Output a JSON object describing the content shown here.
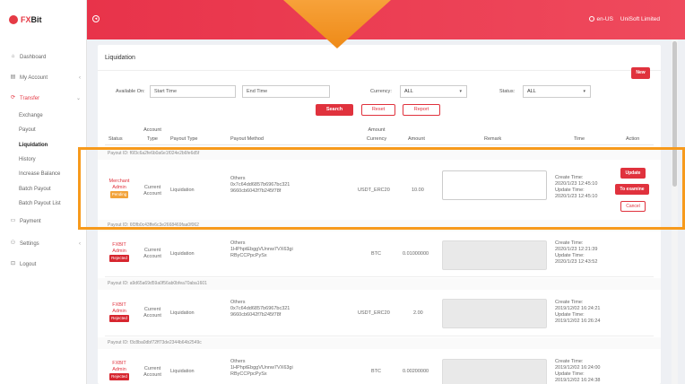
{
  "brand": {
    "prefix": "FX",
    "suffix": "Bit"
  },
  "topbar": {
    "language": "en-US",
    "company": "UniSoft Limited"
  },
  "sidebar": {
    "items": [
      {
        "label": "Dashboard",
        "icon": "home-icon"
      },
      {
        "label": "My Account",
        "icon": "account-icon"
      },
      {
        "label": "Transfer",
        "icon": "transfer-icon"
      }
    ],
    "transfer_sub": [
      "Exchange",
      "Payout",
      "Liquidation",
      "History",
      "Increase Balance",
      "Batch Payout",
      "Batch Payout List"
    ],
    "payment": "Payment",
    "settings": "Settings",
    "logout": "Logout"
  },
  "page": {
    "title": "Liquidation",
    "new_label": "New",
    "filters": {
      "available_on": "Available On",
      "start_placeholder": "Start Time",
      "end_placeholder": "End Time",
      "currency_label": "Currency",
      "currency_value": "ALL",
      "status_label": "Status",
      "status_value": "ALL",
      "search": "Search",
      "reset": "Reset",
      "report": "Report"
    },
    "columns": {
      "status": "Status",
      "account_type_1": "Account",
      "account_type_2": "Type",
      "payout_type": "Payout Type",
      "payout_method": "Payout Method",
      "amount_currency_1": "Amount",
      "amount_currency_2": "Currency",
      "amount": "Amount",
      "remark": "Remark",
      "time": "Time",
      "action": "Action"
    }
  },
  "rows": [
    {
      "payout_id": "Payout ID: f6f3c6a2fe6b0a6e1f024e2b6fe6d5f",
      "status_1": "Merchant",
      "status_2": "Admin",
      "badge": "Pending",
      "account_1": "Current",
      "account_2": "Account",
      "payout_type": "Liquidation",
      "method_1": "Others",
      "method_2": "0x7c64dd6857b6967bc321",
      "method_3": "9660cb6042f7b245f78f",
      "currency": "USDT_ERC20",
      "amount": "10.00",
      "create_label": "Create Time:",
      "create_time": "2020/1/23 12:45:10",
      "update_label": "Update Time:",
      "update_time": "2020/1/23 12:45:10",
      "actions": {
        "update": "Update",
        "examine": "To examine",
        "cancel": "Cancel"
      }
    },
    {
      "payout_id": "Payout ID: 6f3fb0c43ffe6c3e2668469faa0f062",
      "status_1": "FXBIT",
      "status_2": "Admin",
      "badge": "Rejected",
      "account_1": "Current",
      "account_2": "Account",
      "payout_type": "Liquidation",
      "method_1": "Others",
      "method_2": "1HPhptEbggVUnnw7VX63gi",
      "method_3": "RByCCPpcPySx",
      "currency": "BTC",
      "amount": "0.01000000",
      "create_label": "Create Time:",
      "create_time": "2020/1/23 12:21:39",
      "update_label": "Update Time:",
      "update_time": "2020/1/23 12:43:52"
    },
    {
      "payout_id": "Payout ID: a9d65a69d59a0f56ab0bfea70aba1601",
      "status_1": "FXBIT",
      "status_2": "Admin",
      "badge": "Rejected",
      "account_1": "Current",
      "account_2": "Account",
      "payout_type": "Liquidation",
      "method_1": "Others",
      "method_2": "0x7c64dd6857b6967bc321",
      "method_3": "9660cb6042f7b245f78f",
      "currency": "USDT_ERC20",
      "amount": "2.00",
      "create_label": "Create Time:",
      "create_time": "2019/12/02 16:24:21",
      "update_label": "Update Time:",
      "update_time": "2019/12/02 16:26:24"
    },
    {
      "payout_id": "Payout ID: f3c8ba0dbf72ff73de2344b64b2549c",
      "status_1": "FXBIT",
      "status_2": "Admin",
      "badge": "Rejected",
      "account_1": "Current",
      "account_2": "Account",
      "payout_type": "Liquidation",
      "method_1": "Others",
      "method_2": "1HPhptEbggVUnnw7VX63gi",
      "method_3": "RByCCPpcPySx",
      "currency": "BTC",
      "amount": "0.00200000",
      "create_label": "Create Time:",
      "create_time": "2019/12/02 16:24:00",
      "update_label": "Update Time:",
      "update_time": "2019/12/02 16:24:38"
    }
  ],
  "colors": {
    "brand_red": "#e53a45",
    "highlight_orange": "#f79a1c",
    "pending": "#f2a33a",
    "rejected": "#d7262f"
  }
}
